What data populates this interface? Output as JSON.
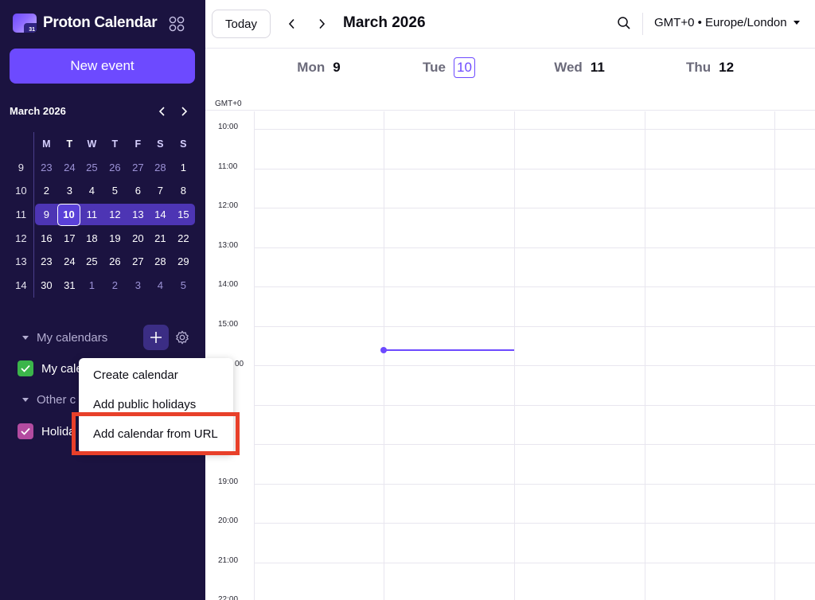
{
  "sidebar": {
    "brand": "Proton Calendar",
    "logo_badge": "31",
    "new_event_label": "New event",
    "mini_calendar": {
      "title": "March 2026",
      "weekday_headers": [
        "M",
        "T",
        "W",
        "T",
        "F",
        "S",
        "S"
      ],
      "weeks": [
        {
          "week": "9",
          "days": [
            "23",
            "24",
            "25",
            "26",
            "27",
            "28",
            "1"
          ]
        },
        {
          "week": "10",
          "days": [
            "2",
            "3",
            "4",
            "5",
            "6",
            "7",
            "8"
          ]
        },
        {
          "week": "11",
          "days": [
            "9",
            "10",
            "11",
            "12",
            "13",
            "14",
            "15"
          ]
        },
        {
          "week": "12",
          "days": [
            "16",
            "17",
            "18",
            "19",
            "20",
            "21",
            "22"
          ]
        },
        {
          "week": "13",
          "days": [
            "23",
            "24",
            "25",
            "26",
            "27",
            "28",
            "29"
          ]
        },
        {
          "week": "14",
          "days": [
            "30",
            "31",
            "1",
            "2",
            "3",
            "4",
            "5"
          ]
        }
      ]
    },
    "my_calendars_label": "My calendars",
    "my_calendar_item": "My cale",
    "other_calendars_label": "Other c",
    "holidays_item": "Holida"
  },
  "toolbar": {
    "today_label": "Today",
    "month_title": "March 2026",
    "timezone": "GMT+0 • Europe/London"
  },
  "days": [
    {
      "name": "Mon",
      "date": "9"
    },
    {
      "name": "Tue",
      "date": "10"
    },
    {
      "name": "Wed",
      "date": "11"
    },
    {
      "name": "Thu",
      "date": "12"
    }
  ],
  "tz_label": "GMT+0",
  "hours": [
    "10:00",
    "11:00",
    "12:00",
    "13:00",
    "14:00",
    "15:00",
    "",
    "",
    "",
    "19:00",
    "20:00",
    "21:00",
    "22:00"
  ],
  "hidden_hour_fragment": "00",
  "dropdown": {
    "items": [
      "Create calendar",
      "Add public holidays",
      "Add calendar from URL"
    ]
  },
  "colors": {
    "accent": "#6d4aff",
    "sidebar_bg": "#1b1340",
    "my_calendar_color": "#3bb54a",
    "holidays_color": "#b34ba0",
    "highlight": "#e8402a"
  }
}
